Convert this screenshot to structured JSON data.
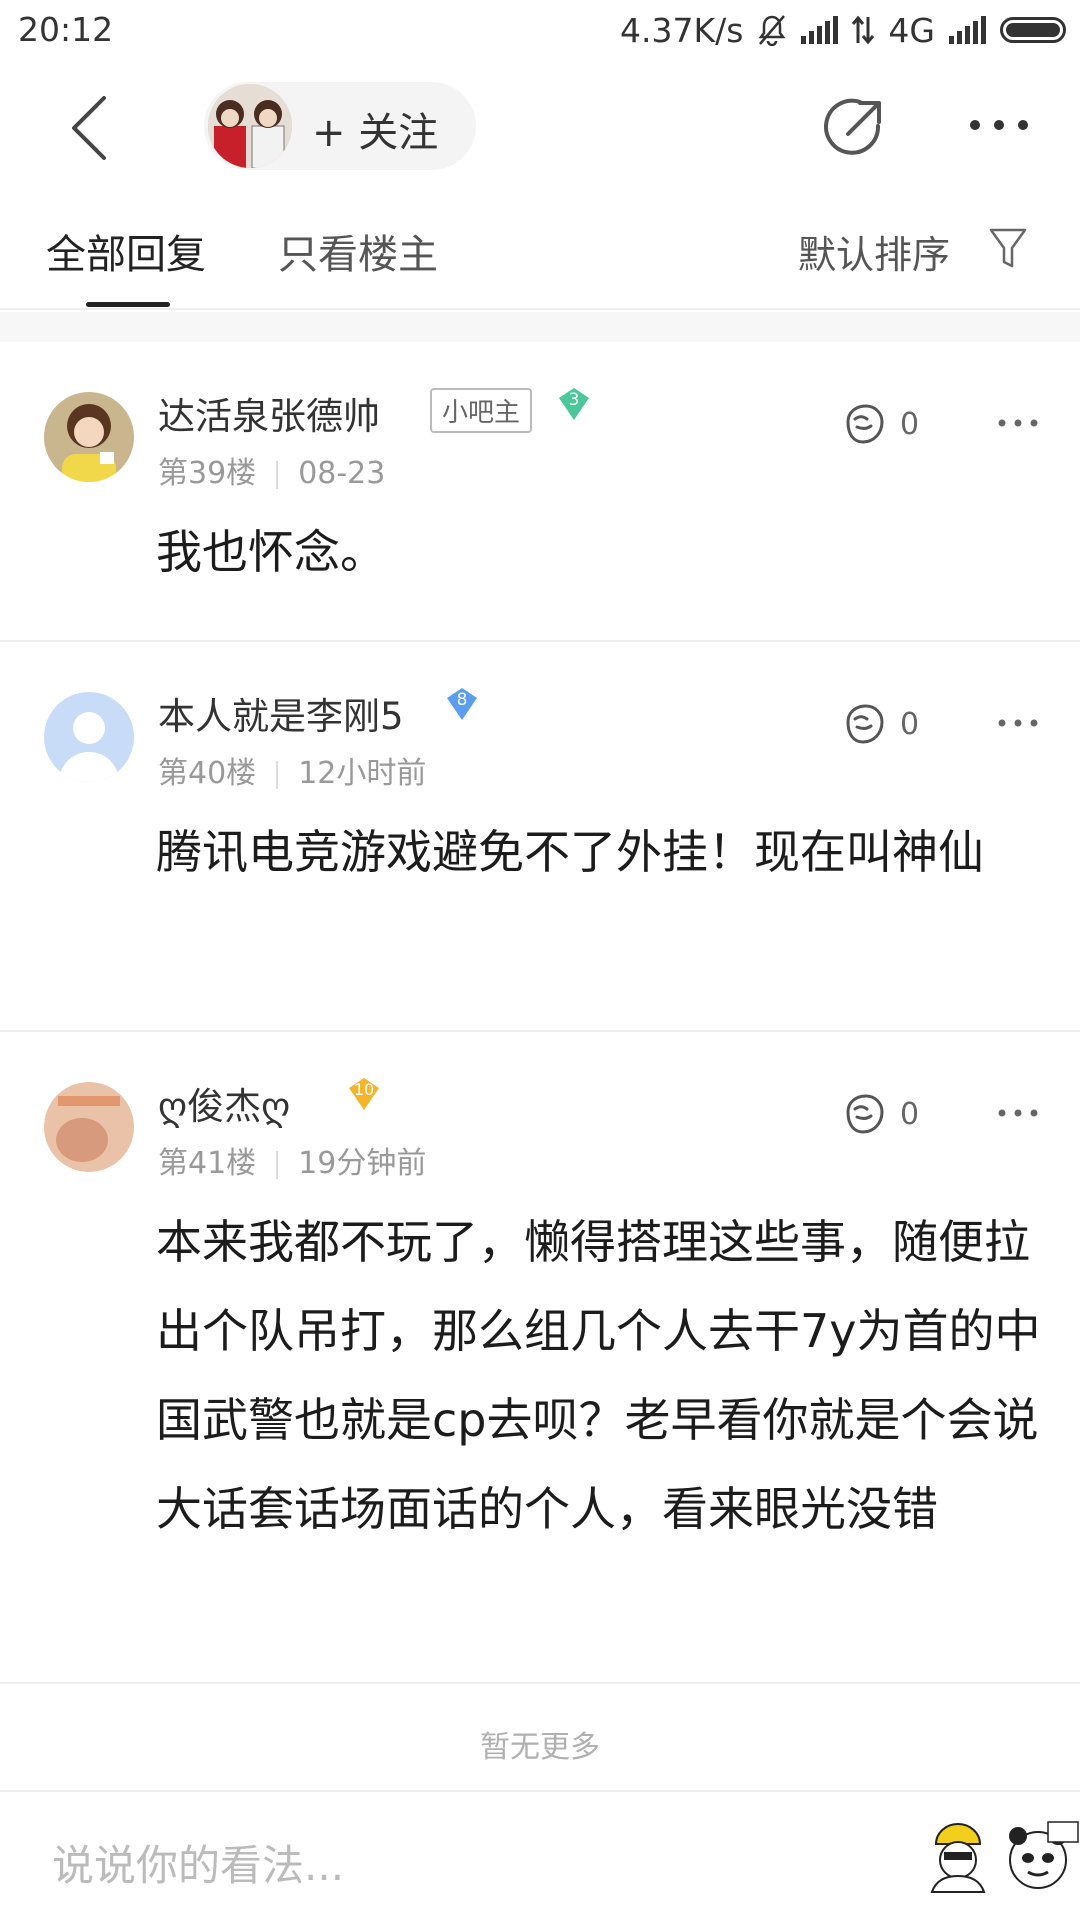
{
  "status_bar": {
    "time": "20:12",
    "net_speed": "4.37K/s",
    "network": "4G",
    "icons": [
      "mute-bell-icon",
      "signal-icon",
      "data-arrows-icon",
      "signal-icon",
      "battery-icon"
    ]
  },
  "header": {
    "follow_label": "+ 关注",
    "icons": [
      "back-icon",
      "share-icon",
      "more-icon"
    ]
  },
  "tabs": {
    "all_replies": "全部回复",
    "op_only": "只看楼主",
    "sort": "默认排序"
  },
  "posts": [
    {
      "username": "达活泉张德帅",
      "role_badge": "小吧主",
      "level": "3",
      "level_color": "#4cc79a",
      "floor": "第39楼",
      "time": "08-23",
      "likes": "0",
      "content": "我也怀念。"
    },
    {
      "username": "本人就是李刚5",
      "role_badge": "",
      "level": "8",
      "level_color": "#5b9ef0",
      "floor": "第40楼",
      "time": "12小时前",
      "likes": "0",
      "content": "腾讯电竞游戏避免不了外挂！现在叫神仙"
    },
    {
      "username": "ღ俊杰ღ",
      "role_badge": "",
      "level": "10",
      "level_color": "#f5b52a",
      "floor": "第41楼",
      "time": "19分钟前",
      "likes": "0",
      "content": "本来我都不玩了，懒得搭理这些事，随便拉出个队吊打，那么组几个人去干7y为首的中国武警也就是cp去呗？老早看你就是个会说大话套话场面话的个人，看来眼光没错"
    }
  ],
  "footer": {
    "no_more": "暂无更多",
    "input_placeholder": "说说你的看法..."
  }
}
